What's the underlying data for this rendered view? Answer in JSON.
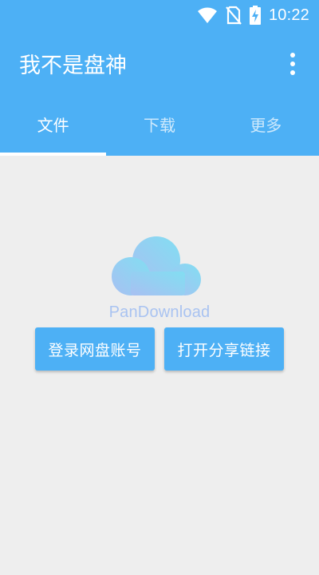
{
  "status_bar": {
    "time": "10:22",
    "icons": [
      "wifi-icon",
      "no-sim-icon",
      "battery-charging-icon"
    ]
  },
  "app_bar": {
    "title": "我不是盘神",
    "menu_icon": "more-vert-icon"
  },
  "tabs": [
    {
      "label": "文件",
      "active": true
    },
    {
      "label": "下载",
      "active": false
    },
    {
      "label": "更多",
      "active": false
    }
  ],
  "empty_state": {
    "icon": "cloud-icon",
    "brand": "PanDownload",
    "buttons": {
      "login": "登录网盘账号",
      "share": "打开分享链接"
    }
  },
  "colors": {
    "primary": "#4db0f5",
    "background": "#eeeeee",
    "brand_text": "#a9c3f1"
  }
}
